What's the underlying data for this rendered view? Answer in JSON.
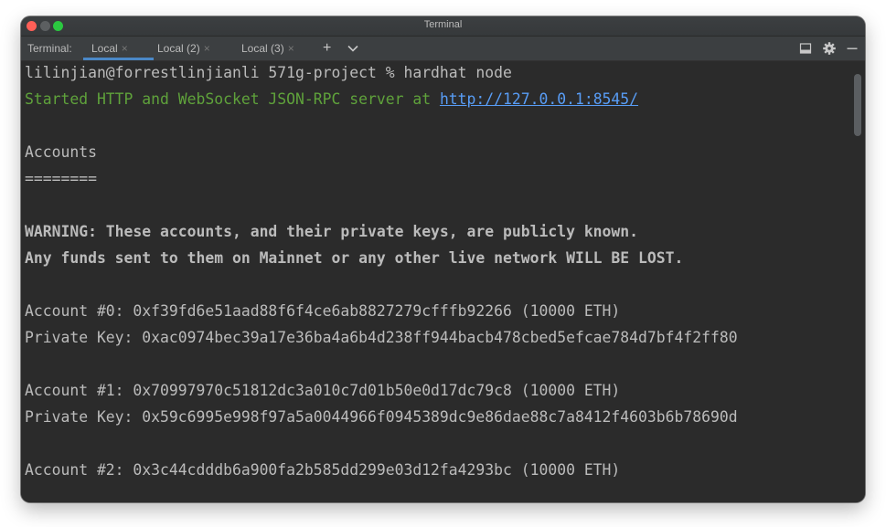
{
  "window": {
    "title": "Terminal"
  },
  "tabbar": {
    "label": "Terminal:",
    "tabs": [
      {
        "label": "Local",
        "close": "×"
      },
      {
        "label": "Local (2)",
        "close": "×"
      },
      {
        "label": "Local (3)",
        "close": "×"
      }
    ],
    "new_tab": "+",
    "dropdown": "⌄"
  },
  "terminal": {
    "prompt": "lilinjian@forrestlinjianli 571g-project % hardhat node",
    "started_prefix": "Started HTTP and WebSocket JSON-RPC server at ",
    "server_url": "http://127.0.0.1:8545/",
    "accounts_title": "Accounts",
    "accounts_rule": "========",
    "warning_line1": "WARNING: These accounts, and their private keys, are publicly known.",
    "warning_line2": "Any funds sent to them on Mainnet or any other live network WILL BE LOST.",
    "accounts": [
      {
        "account_line": "Account #0: 0xf39fd6e51aad88f6f4ce6ab8827279cfffb92266 (10000 ETH)",
        "key_line": "Private Key: 0xac0974bec39a17e36ba4a6b4d238ff944bacb478cbed5efcae784d7bf4f2ff80"
      },
      {
        "account_line": "Account #1: 0x70997970c51812dc3a010c7d01b50e0d17dc79c8 (10000 ETH)",
        "key_line": "Private Key: 0x59c6995e998f97a5a0044966f0945389dc9e86dae88c7a8412f4603b6b78690d"
      },
      {
        "account_line": "Account #2: 0x3c44cdddb6a900fa2b585dd299e03d12fa4293bc (10000 ETH)"
      }
    ]
  },
  "colors": {
    "background": "#2b2b2b",
    "text": "#bbbbbb",
    "green": "#5fa23b",
    "link": "#589df6",
    "accent": "#4a88c7"
  }
}
